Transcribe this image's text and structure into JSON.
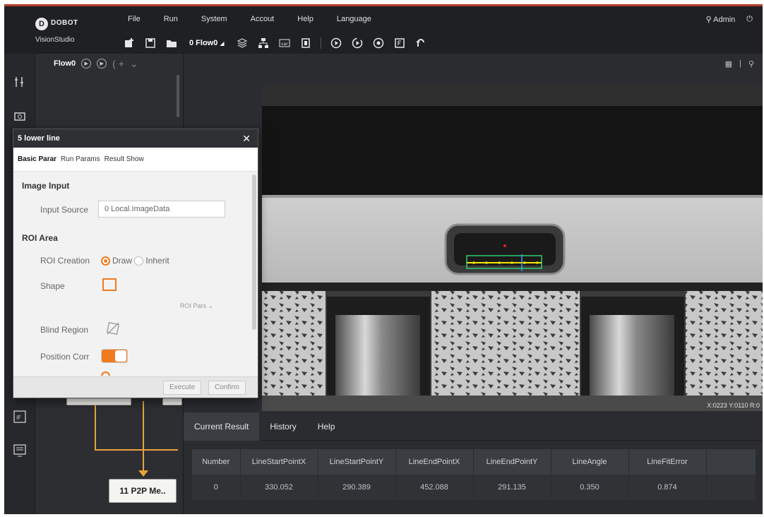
{
  "app": {
    "brand": "DOBOT",
    "product": "VisionStudio",
    "logo_letter": "D"
  },
  "menu": [
    "File",
    "Run",
    "System",
    "Accout",
    "Help",
    "Language"
  ],
  "user": {
    "name": "Admin"
  },
  "toolbar": {
    "flow_select": "0 Flow0"
  },
  "flow": {
    "tab_title": "Flow0",
    "nodes": {
      "top_left": "",
      "top_right": "",
      "bottom": "11 P2P Me.."
    }
  },
  "viewer": {
    "coordinate_text": "X:0223  Y:0110  R:0"
  },
  "results": {
    "tabs": [
      "Current Result",
      "History",
      "Help"
    ],
    "active_tab": "Current Result",
    "columns": [
      "Number",
      "LineStartPointX",
      "LineStartPointY",
      "LineEndPointX",
      "LineEndPointY",
      "LineAngle",
      "LineFitError"
    ],
    "rows": [
      [
        "0",
        "330.052",
        "290.389",
        "452.088",
        "291.135",
        "0.350",
        "0.874"
      ]
    ]
  },
  "dialog": {
    "title": "5 lower line",
    "tabs": [
      "Basic Parar",
      "Run Params",
      "Result Show"
    ],
    "active_tab": "Basic Parar",
    "image_input_section": "Image Input",
    "input_source_label": "Input Source",
    "input_source_value": "0 Local.ImageData",
    "roi_section": "ROI Area",
    "roi_creation_label": "ROI Creation",
    "roi_option_draw": "Draw",
    "roi_option_inherit": "Inherit",
    "roi_creation_selected": "Draw",
    "shape_label": "Shape",
    "roi_params_label": "ROI Pars",
    "blind_region_label": "Blind Region",
    "position_correction_label": "Position Corr",
    "position_correction_on": true,
    "execute_label": "Execute",
    "confirm_label": "Confirm"
  },
  "colors": {
    "accent": "#f07a20",
    "wire": "#e8a33b",
    "roi_line": "#f2e500",
    "roi_box": "#2ecc71",
    "caliper": "#3aa0ff"
  }
}
